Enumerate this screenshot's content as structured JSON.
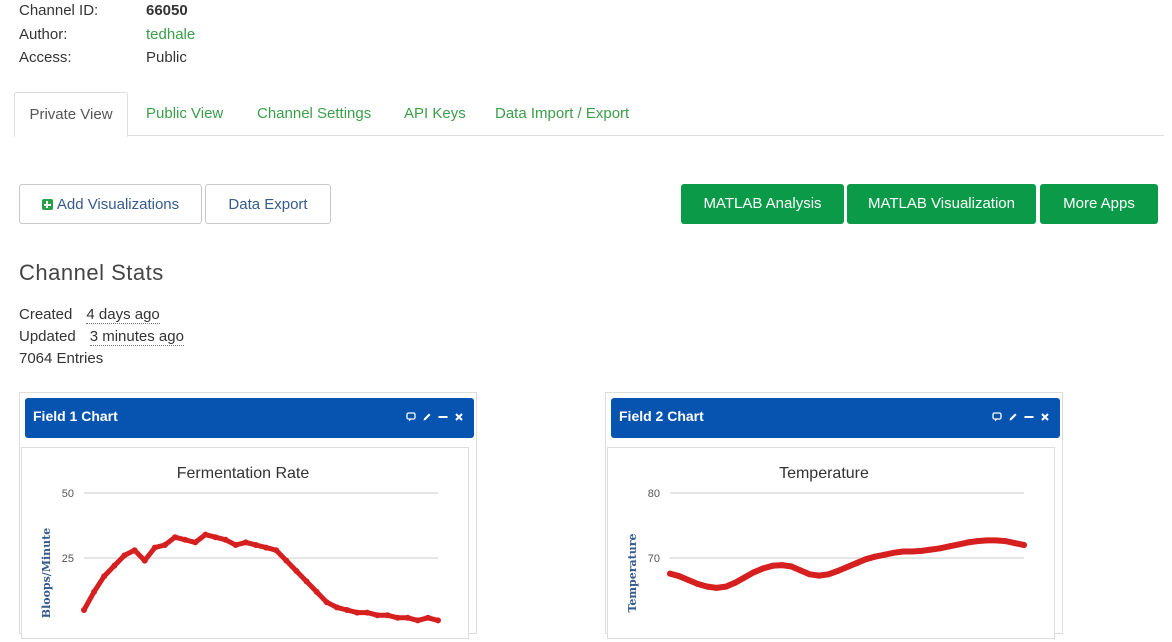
{
  "meta": {
    "channel_id_label": "Channel ID:",
    "channel_id": "66050",
    "author_label": "Author:",
    "author": "tedhale",
    "access_label": "Access:",
    "access": "Public"
  },
  "tabs": [
    "Private View",
    "Public View",
    "Channel Settings",
    "API Keys",
    "Data Import / Export"
  ],
  "toolbar": {
    "add_visualizations": "Add Visualizations",
    "data_export": "Data Export",
    "matlab_analysis": "MATLAB Analysis",
    "matlab_visualization": "MATLAB Visualization",
    "more_apps": "More Apps"
  },
  "stats": {
    "title": "Channel Stats",
    "created_label": "Created",
    "created": "4 days ago",
    "updated_label": "Updated",
    "updated": "3 minutes ago",
    "entries": "7064 Entries"
  },
  "colors": {
    "accent_green": "#0b9a47",
    "link_green": "#3a9f48",
    "panel_blue": "#0754b0",
    "series_red": "#d62020"
  },
  "panels": [
    {
      "title": "Field 1 Chart"
    },
    {
      "title": "Field 2 Chart"
    }
  ],
  "chart_data": [
    {
      "type": "line",
      "title": "Fermentation Rate",
      "ylabel": "Bloops/Minute",
      "yticks": [
        "50",
        "25"
      ],
      "ylim": [
        0,
        50
      ],
      "series": [
        {
          "values": [
            5,
            12,
            18,
            22,
            26,
            28,
            24,
            29,
            30,
            33,
            32,
            31,
            34,
            33,
            32,
            30,
            31,
            30,
            29,
            28,
            24,
            20,
            16,
            12,
            8,
            6,
            5,
            4,
            4,
            3,
            3,
            2,
            2,
            1,
            2,
            1
          ]
        }
      ]
    },
    {
      "type": "line",
      "title": "Temperature",
      "ylabel": "Temperature",
      "yticks": [
        "80",
        "70"
      ],
      "ylim": [
        60,
        80
      ],
      "series": [
        {
          "values": [
            67.6,
            67.2,
            66.6,
            66.0,
            65.6,
            65.4,
            65.6,
            66.2,
            67.0,
            67.8,
            68.4,
            68.8,
            68.9,
            68.7,
            68.1,
            67.5,
            67.3,
            67.5,
            68.0,
            68.6,
            69.2,
            69.8,
            70.2,
            70.5,
            70.8,
            71.0,
            71.0,
            71.1,
            71.3,
            71.5,
            71.8,
            72.1,
            72.4,
            72.6,
            72.7,
            72.7,
            72.6,
            72.3,
            72.0
          ]
        }
      ]
    }
  ]
}
